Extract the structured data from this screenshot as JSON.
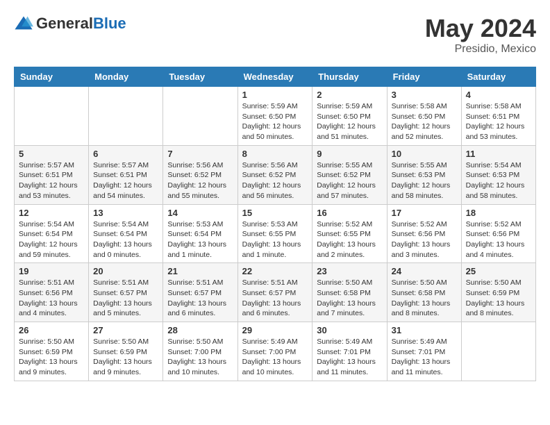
{
  "header": {
    "logo_general": "General",
    "logo_blue": "Blue",
    "month": "May 2024",
    "location": "Presidio, Mexico"
  },
  "weekdays": [
    "Sunday",
    "Monday",
    "Tuesday",
    "Wednesday",
    "Thursday",
    "Friday",
    "Saturday"
  ],
  "weeks": [
    [
      null,
      null,
      null,
      {
        "day": 1,
        "sunrise": "5:59 AM",
        "sunset": "6:50 PM",
        "daylight": "12 hours and 50 minutes."
      },
      {
        "day": 2,
        "sunrise": "5:59 AM",
        "sunset": "6:50 PM",
        "daylight": "12 hours and 51 minutes."
      },
      {
        "day": 3,
        "sunrise": "5:58 AM",
        "sunset": "6:50 PM",
        "daylight": "12 hours and 52 minutes."
      },
      {
        "day": 4,
        "sunrise": "5:58 AM",
        "sunset": "6:51 PM",
        "daylight": "12 hours and 53 minutes."
      }
    ],
    [
      {
        "day": 5,
        "sunrise": "5:57 AM",
        "sunset": "6:51 PM",
        "daylight": "12 hours and 53 minutes."
      },
      {
        "day": 6,
        "sunrise": "5:57 AM",
        "sunset": "6:51 PM",
        "daylight": "12 hours and 54 minutes."
      },
      {
        "day": 7,
        "sunrise": "5:56 AM",
        "sunset": "6:52 PM",
        "daylight": "12 hours and 55 minutes."
      },
      {
        "day": 8,
        "sunrise": "5:56 AM",
        "sunset": "6:52 PM",
        "daylight": "12 hours and 56 minutes."
      },
      {
        "day": 9,
        "sunrise": "5:55 AM",
        "sunset": "6:52 PM",
        "daylight": "12 hours and 57 minutes."
      },
      {
        "day": 10,
        "sunrise": "5:55 AM",
        "sunset": "6:53 PM",
        "daylight": "12 hours and 58 minutes."
      },
      {
        "day": 11,
        "sunrise": "5:54 AM",
        "sunset": "6:53 PM",
        "daylight": "12 hours and 58 minutes."
      }
    ],
    [
      {
        "day": 12,
        "sunrise": "5:54 AM",
        "sunset": "6:54 PM",
        "daylight": "12 hours and 59 minutes."
      },
      {
        "day": 13,
        "sunrise": "5:54 AM",
        "sunset": "6:54 PM",
        "daylight": "13 hours and 0 minutes."
      },
      {
        "day": 14,
        "sunrise": "5:53 AM",
        "sunset": "6:54 PM",
        "daylight": "13 hours and 1 minute."
      },
      {
        "day": 15,
        "sunrise": "5:53 AM",
        "sunset": "6:55 PM",
        "daylight": "13 hours and 1 minute."
      },
      {
        "day": 16,
        "sunrise": "5:52 AM",
        "sunset": "6:55 PM",
        "daylight": "13 hours and 2 minutes."
      },
      {
        "day": 17,
        "sunrise": "5:52 AM",
        "sunset": "6:56 PM",
        "daylight": "13 hours and 3 minutes."
      },
      {
        "day": 18,
        "sunrise": "5:52 AM",
        "sunset": "6:56 PM",
        "daylight": "13 hours and 4 minutes."
      }
    ],
    [
      {
        "day": 19,
        "sunrise": "5:51 AM",
        "sunset": "6:56 PM",
        "daylight": "13 hours and 4 minutes."
      },
      {
        "day": 20,
        "sunrise": "5:51 AM",
        "sunset": "6:57 PM",
        "daylight": "13 hours and 5 minutes."
      },
      {
        "day": 21,
        "sunrise": "5:51 AM",
        "sunset": "6:57 PM",
        "daylight": "13 hours and 6 minutes."
      },
      {
        "day": 22,
        "sunrise": "5:51 AM",
        "sunset": "6:57 PM",
        "daylight": "13 hours and 6 minutes."
      },
      {
        "day": 23,
        "sunrise": "5:50 AM",
        "sunset": "6:58 PM",
        "daylight": "13 hours and 7 minutes."
      },
      {
        "day": 24,
        "sunrise": "5:50 AM",
        "sunset": "6:58 PM",
        "daylight": "13 hours and 8 minutes."
      },
      {
        "day": 25,
        "sunrise": "5:50 AM",
        "sunset": "6:59 PM",
        "daylight": "13 hours and 8 minutes."
      }
    ],
    [
      {
        "day": 26,
        "sunrise": "5:50 AM",
        "sunset": "6:59 PM",
        "daylight": "13 hours and 9 minutes."
      },
      {
        "day": 27,
        "sunrise": "5:50 AM",
        "sunset": "6:59 PM",
        "daylight": "13 hours and 9 minutes."
      },
      {
        "day": 28,
        "sunrise": "5:50 AM",
        "sunset": "7:00 PM",
        "daylight": "13 hours and 10 minutes."
      },
      {
        "day": 29,
        "sunrise": "5:49 AM",
        "sunset": "7:00 PM",
        "daylight": "13 hours and 10 minutes."
      },
      {
        "day": 30,
        "sunrise": "5:49 AM",
        "sunset": "7:01 PM",
        "daylight": "13 hours and 11 minutes."
      },
      {
        "day": 31,
        "sunrise": "5:49 AM",
        "sunset": "7:01 PM",
        "daylight": "13 hours and 11 minutes."
      },
      null
    ]
  ]
}
